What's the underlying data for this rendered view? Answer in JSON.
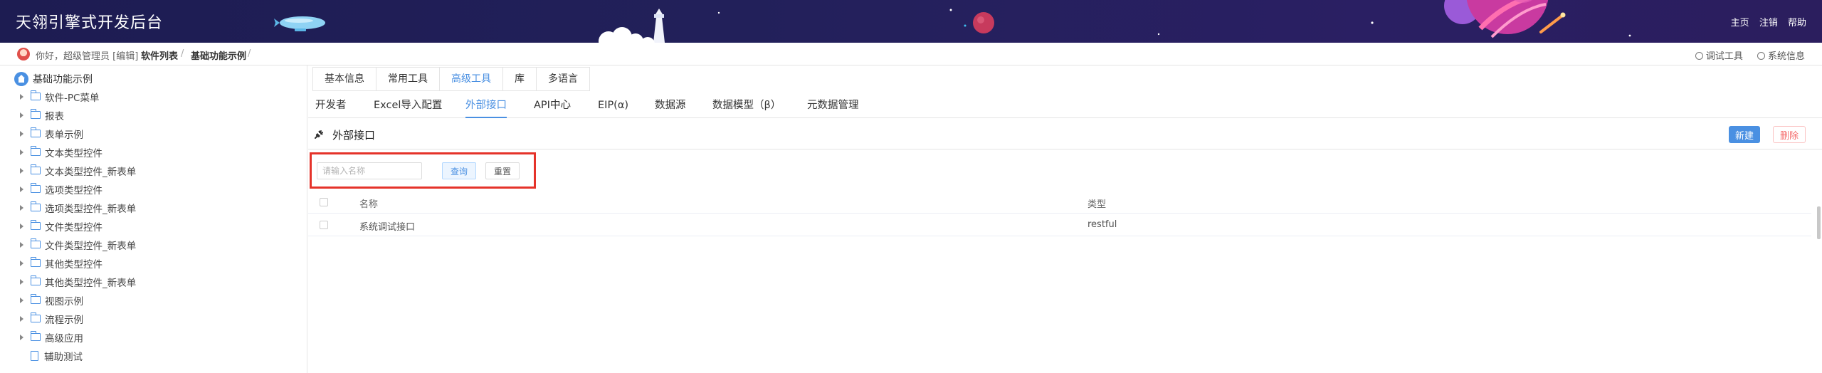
{
  "header": {
    "title": "天翎引擎式开发后台",
    "links": [
      "主页",
      "注销",
      "帮助"
    ]
  },
  "crumbbar": {
    "greeting": "你好，超级管理员 [编辑]",
    "crumbs": [
      "软件列表",
      "基础功能示例"
    ],
    "separator": "/",
    "tools": [
      "调试工具",
      "系统信息"
    ]
  },
  "sidebar": {
    "root": "基础功能示例",
    "items": [
      {
        "label": "软件-PC菜单",
        "icon": "folder-icon"
      },
      {
        "label": "报表",
        "icon": "folder-icon"
      },
      {
        "label": "表单示例",
        "icon": "folder-icon"
      },
      {
        "label": "文本类型控件",
        "icon": "folder-icon"
      },
      {
        "label": "文本类型控件_新表单",
        "icon": "folder-icon"
      },
      {
        "label": "选项类型控件",
        "icon": "folder-icon"
      },
      {
        "label": "选项类型控件_新表单",
        "icon": "folder-icon"
      },
      {
        "label": "文件类型控件",
        "icon": "folder-icon"
      },
      {
        "label": "文件类型控件_新表单",
        "icon": "folder-icon"
      },
      {
        "label": "其他类型控件",
        "icon": "folder-icon"
      },
      {
        "label": "其他类型控件_新表单",
        "icon": "folder-icon"
      },
      {
        "label": "视图示例",
        "icon": "folder-icon"
      },
      {
        "label": "流程示例",
        "icon": "folder-icon"
      },
      {
        "label": "高级应用",
        "icon": "folder-icon"
      },
      {
        "label": "辅助测试",
        "icon": "document-icon"
      }
    ]
  },
  "main": {
    "top_tabs": [
      "基本信息",
      "常用工具",
      "高级工具",
      "库",
      "多语言"
    ],
    "active_top_tab": "高级工具",
    "sub_tabs": [
      "开发者",
      "Excel导入配置",
      "外部接口",
      "API中心",
      "EIP(α)",
      "数据源",
      "数据模型（β）",
      "元数据管理"
    ],
    "active_sub_tab": "外部接口",
    "section_title": "外部接口",
    "buttons": {
      "new": "新建",
      "delete": "删除"
    },
    "search": {
      "placeholder": "请输入名称",
      "value": "",
      "query": "查询",
      "reset": "重置"
    },
    "table": {
      "columns": [
        "名称",
        "类型"
      ],
      "rows": [
        {
          "name": "系统调试接口",
          "type": "restful"
        }
      ]
    }
  },
  "colors": {
    "header_bg": "#1d1c52",
    "accent": "#4a90e2",
    "danger": "#f56c6c",
    "highlight_box": "#e5332a"
  }
}
